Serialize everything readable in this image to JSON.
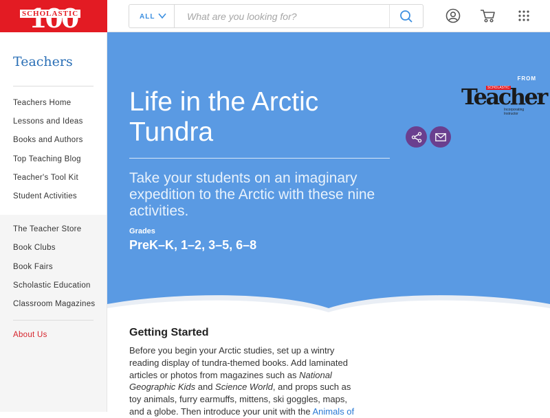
{
  "header": {
    "logo": {
      "number": "100",
      "word": "SCHOLASTIC"
    },
    "search": {
      "category": "ALL",
      "placeholder": "What are you looking for?"
    },
    "icons": [
      "account-icon",
      "cart-icon",
      "apps-grid-icon"
    ]
  },
  "sidebar": {
    "title": "Teachers",
    "group1": [
      "Teachers Home",
      "Lessons and Ideas",
      "Books and Authors",
      "Top Teaching Blog",
      "Teacher's Tool Kit",
      "Student Activities"
    ],
    "group2": [
      "The Teacher Store",
      "Book Clubs",
      "Book Fairs",
      "Scholastic Education",
      "Classroom Magazines"
    ],
    "group3": [
      "About Us"
    ]
  },
  "hero": {
    "from_label": "FROM",
    "brand": {
      "word": "Teacher",
      "tag": "SCHOLASTIC",
      "sub": "Incorporating Instructor"
    },
    "title": "Life in the Arctic Tundra",
    "subtitle": "Take your students on an imaginary expedition to the Arctic with these nine activities.",
    "grades_label": "Grades",
    "grades_value": "PreK–K, 1–2, 3–5, 6–8",
    "colors": {
      "background": "#5a9ae3",
      "action_buttons": "#6a3f8f"
    }
  },
  "content": {
    "title": "Getting Started",
    "body_1": "Before you begin your Arctic studies, set up a wintry reading display of tundra-themed books. Add laminated articles or photos from magazines such as ",
    "mag_1": "National Geographic Kids",
    "body_2": " and ",
    "mag_2": "Science World",
    "body_3": ", and props such as toy animals, furry earmuffs, mittens, ski goggles, maps, and a globe. Then introduce your unit with the ",
    "link": "Animals of"
  }
}
